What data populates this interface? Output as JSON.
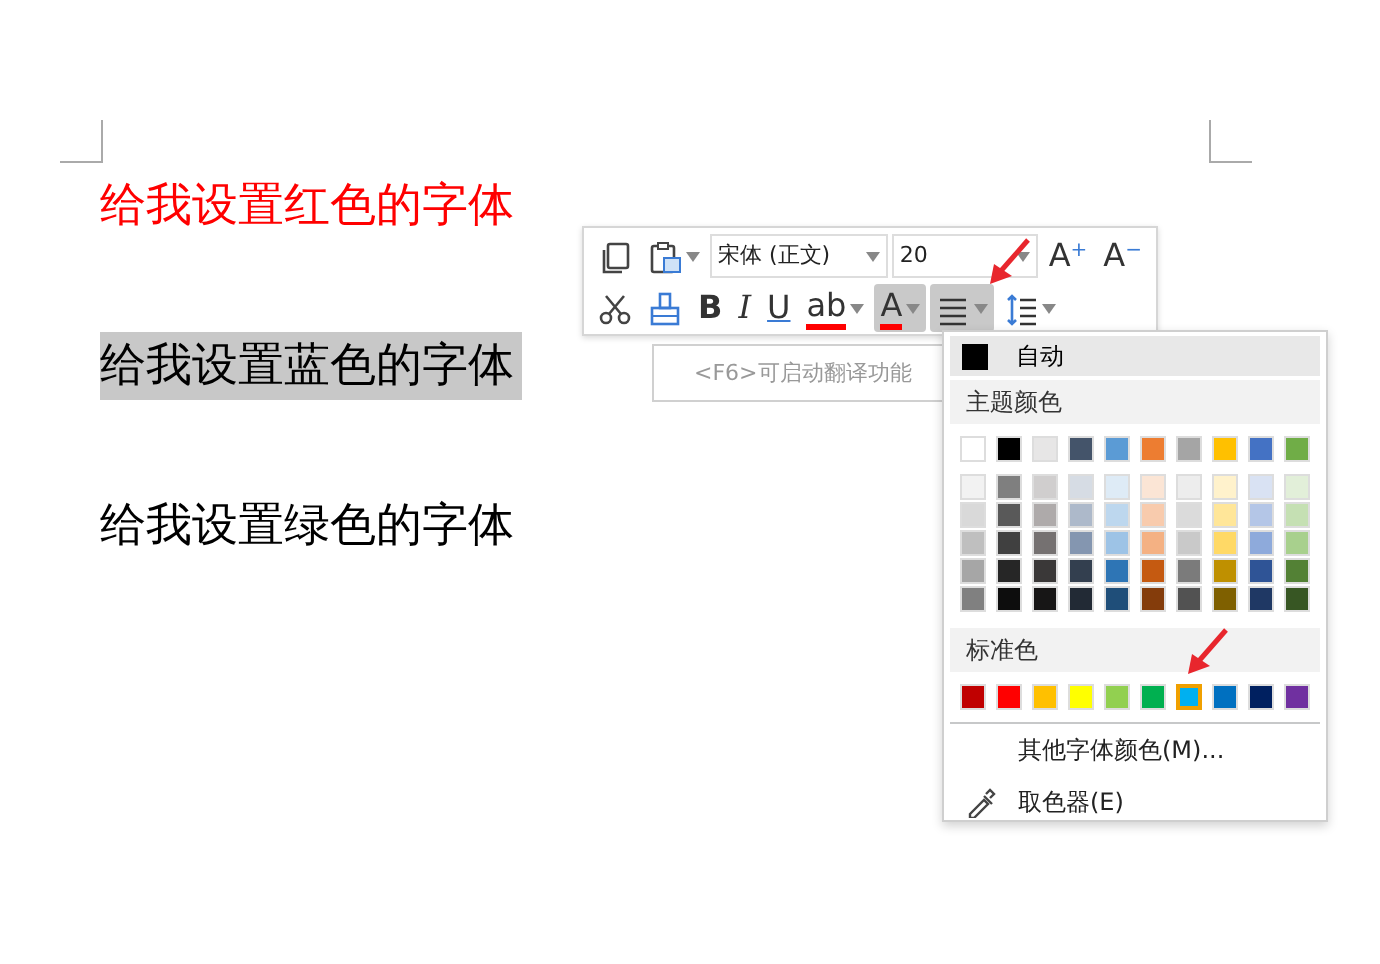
{
  "paragraphs": [
    {
      "text": "给我设置红色的字体",
      "color": "#ff0000",
      "selected": false
    },
    {
      "text": "给我设置蓝色的字体",
      "color": "#000000",
      "selected": true
    },
    {
      "text": "给我设置绿色的字体",
      "color": "#000000",
      "selected": false
    }
  ],
  "translate_hint": "<F6>可启动翻译功能",
  "toolbar": {
    "row_1": [
      {
        "kind": "icon",
        "pressed": false
      },
      {
        "kind": "icon",
        "pressed": false
      },
      {
        "kind": "select",
        "value": "宋体 (正文)"
      },
      {
        "kind": "select",
        "value": "20"
      },
      {
        "kind": "text",
        "text": "A",
        "sup": "+",
        "pressed": false
      },
      {
        "kind": "text",
        "text": "A",
        "sup": "−",
        "pressed": false
      }
    ],
    "row_2": [
      {
        "kind": "icon",
        "pressed": false
      },
      {
        "kind": "icon",
        "pressed": false
      },
      {
        "kind": "text",
        "text": "B",
        "pressed": false
      },
      {
        "kind": "text",
        "text": "I",
        "pressed": false
      },
      {
        "kind": "text",
        "text": "U",
        "pressed": false
      },
      {
        "kind": "text",
        "text": "ab",
        "pressed": false
      },
      {
        "kind": "text",
        "text": "A",
        "pressed": true
      },
      {
        "kind": "icon",
        "pressed": true
      },
      {
        "kind": "icon",
        "pressed": false
      }
    ]
  },
  "color_menu": {
    "auto": {
      "label": "自动",
      "color": "#000000"
    },
    "theme_heading": "主题颜色",
    "theme_colors": [
      {
        "color": "#ffffff"
      },
      {
        "color": "#000000"
      },
      {
        "color": "#e7e6e6"
      },
      {
        "color": "#44546a"
      },
      {
        "color": "#5b9bd5"
      },
      {
        "color": "#ed7d31"
      },
      {
        "color": "#a5a5a5"
      },
      {
        "color": "#ffc000"
      },
      {
        "color": "#4472c4"
      },
      {
        "color": "#70ad47"
      }
    ],
    "shade_rows": [
      [
        {
          "color": "#f2f2f2"
        },
        {
          "color": "#7f7f7f"
        },
        {
          "color": "#d0cece"
        },
        {
          "color": "#d6dce4"
        },
        {
          "color": "#deebf6"
        },
        {
          "color": "#fbe5d5"
        },
        {
          "color": "#ededed"
        },
        {
          "color": "#fff2cc"
        },
        {
          "color": "#d9e2f3"
        },
        {
          "color": "#e2efd9"
        }
      ],
      [
        {
          "color": "#d9d9d9"
        },
        {
          "color": "#595959"
        },
        {
          "color": "#aeaaaa"
        },
        {
          "color": "#adb9ca"
        },
        {
          "color": "#bdd7ee"
        },
        {
          "color": "#f8cbad"
        },
        {
          "color": "#dbdbdb"
        },
        {
          "color": "#ffe699"
        },
        {
          "color": "#b4c6e7"
        },
        {
          "color": "#c5e0b3"
        }
      ],
      [
        {
          "color": "#bfbfbf"
        },
        {
          "color": "#404040"
        },
        {
          "color": "#757171"
        },
        {
          "color": "#8496b0"
        },
        {
          "color": "#9dc3e6"
        },
        {
          "color": "#f4b183"
        },
        {
          "color": "#c9c9c9"
        },
        {
          "color": "#ffd966"
        },
        {
          "color": "#8eaadb"
        },
        {
          "color": "#a8d08d"
        }
      ],
      [
        {
          "color": "#a6a6a6"
        },
        {
          "color": "#262626"
        },
        {
          "color": "#3a3838"
        },
        {
          "color": "#333f4f"
        },
        {
          "color": "#2e75b5"
        },
        {
          "color": "#c55a11"
        },
        {
          "color": "#7b7b7b"
        },
        {
          "color": "#bf9000"
        },
        {
          "color": "#2f5496"
        },
        {
          "color": "#538135"
        }
      ],
      [
        {
          "color": "#808080"
        },
        {
          "color": "#0d0d0d"
        },
        {
          "color": "#171616"
        },
        {
          "color": "#222a35"
        },
        {
          "color": "#1f4e79"
        },
        {
          "color": "#843c0b"
        },
        {
          "color": "#525252"
        },
        {
          "color": "#7f6000"
        },
        {
          "color": "#1f3864"
        },
        {
          "color": "#375623"
        }
      ]
    ],
    "standard_heading": "标准色",
    "standard_colors": [
      {
        "color": "#c00000",
        "selected": false
      },
      {
        "color": "#ff0000",
        "selected": false
      },
      {
        "color": "#ffc000",
        "selected": false
      },
      {
        "color": "#ffff00",
        "selected": false
      },
      {
        "color": "#92d050",
        "selected": false
      },
      {
        "color": "#00b050",
        "selected": false
      },
      {
        "color": "#00b0f0",
        "selected": true
      },
      {
        "color": "#0070c0",
        "selected": false
      },
      {
        "color": "#002060",
        "selected": false
      },
      {
        "color": "#7030a0",
        "selected": false
      }
    ],
    "items": [
      {
        "label": "其他字体颜色(M)..."
      },
      {
        "label": "取色器(E)"
      }
    ]
  }
}
